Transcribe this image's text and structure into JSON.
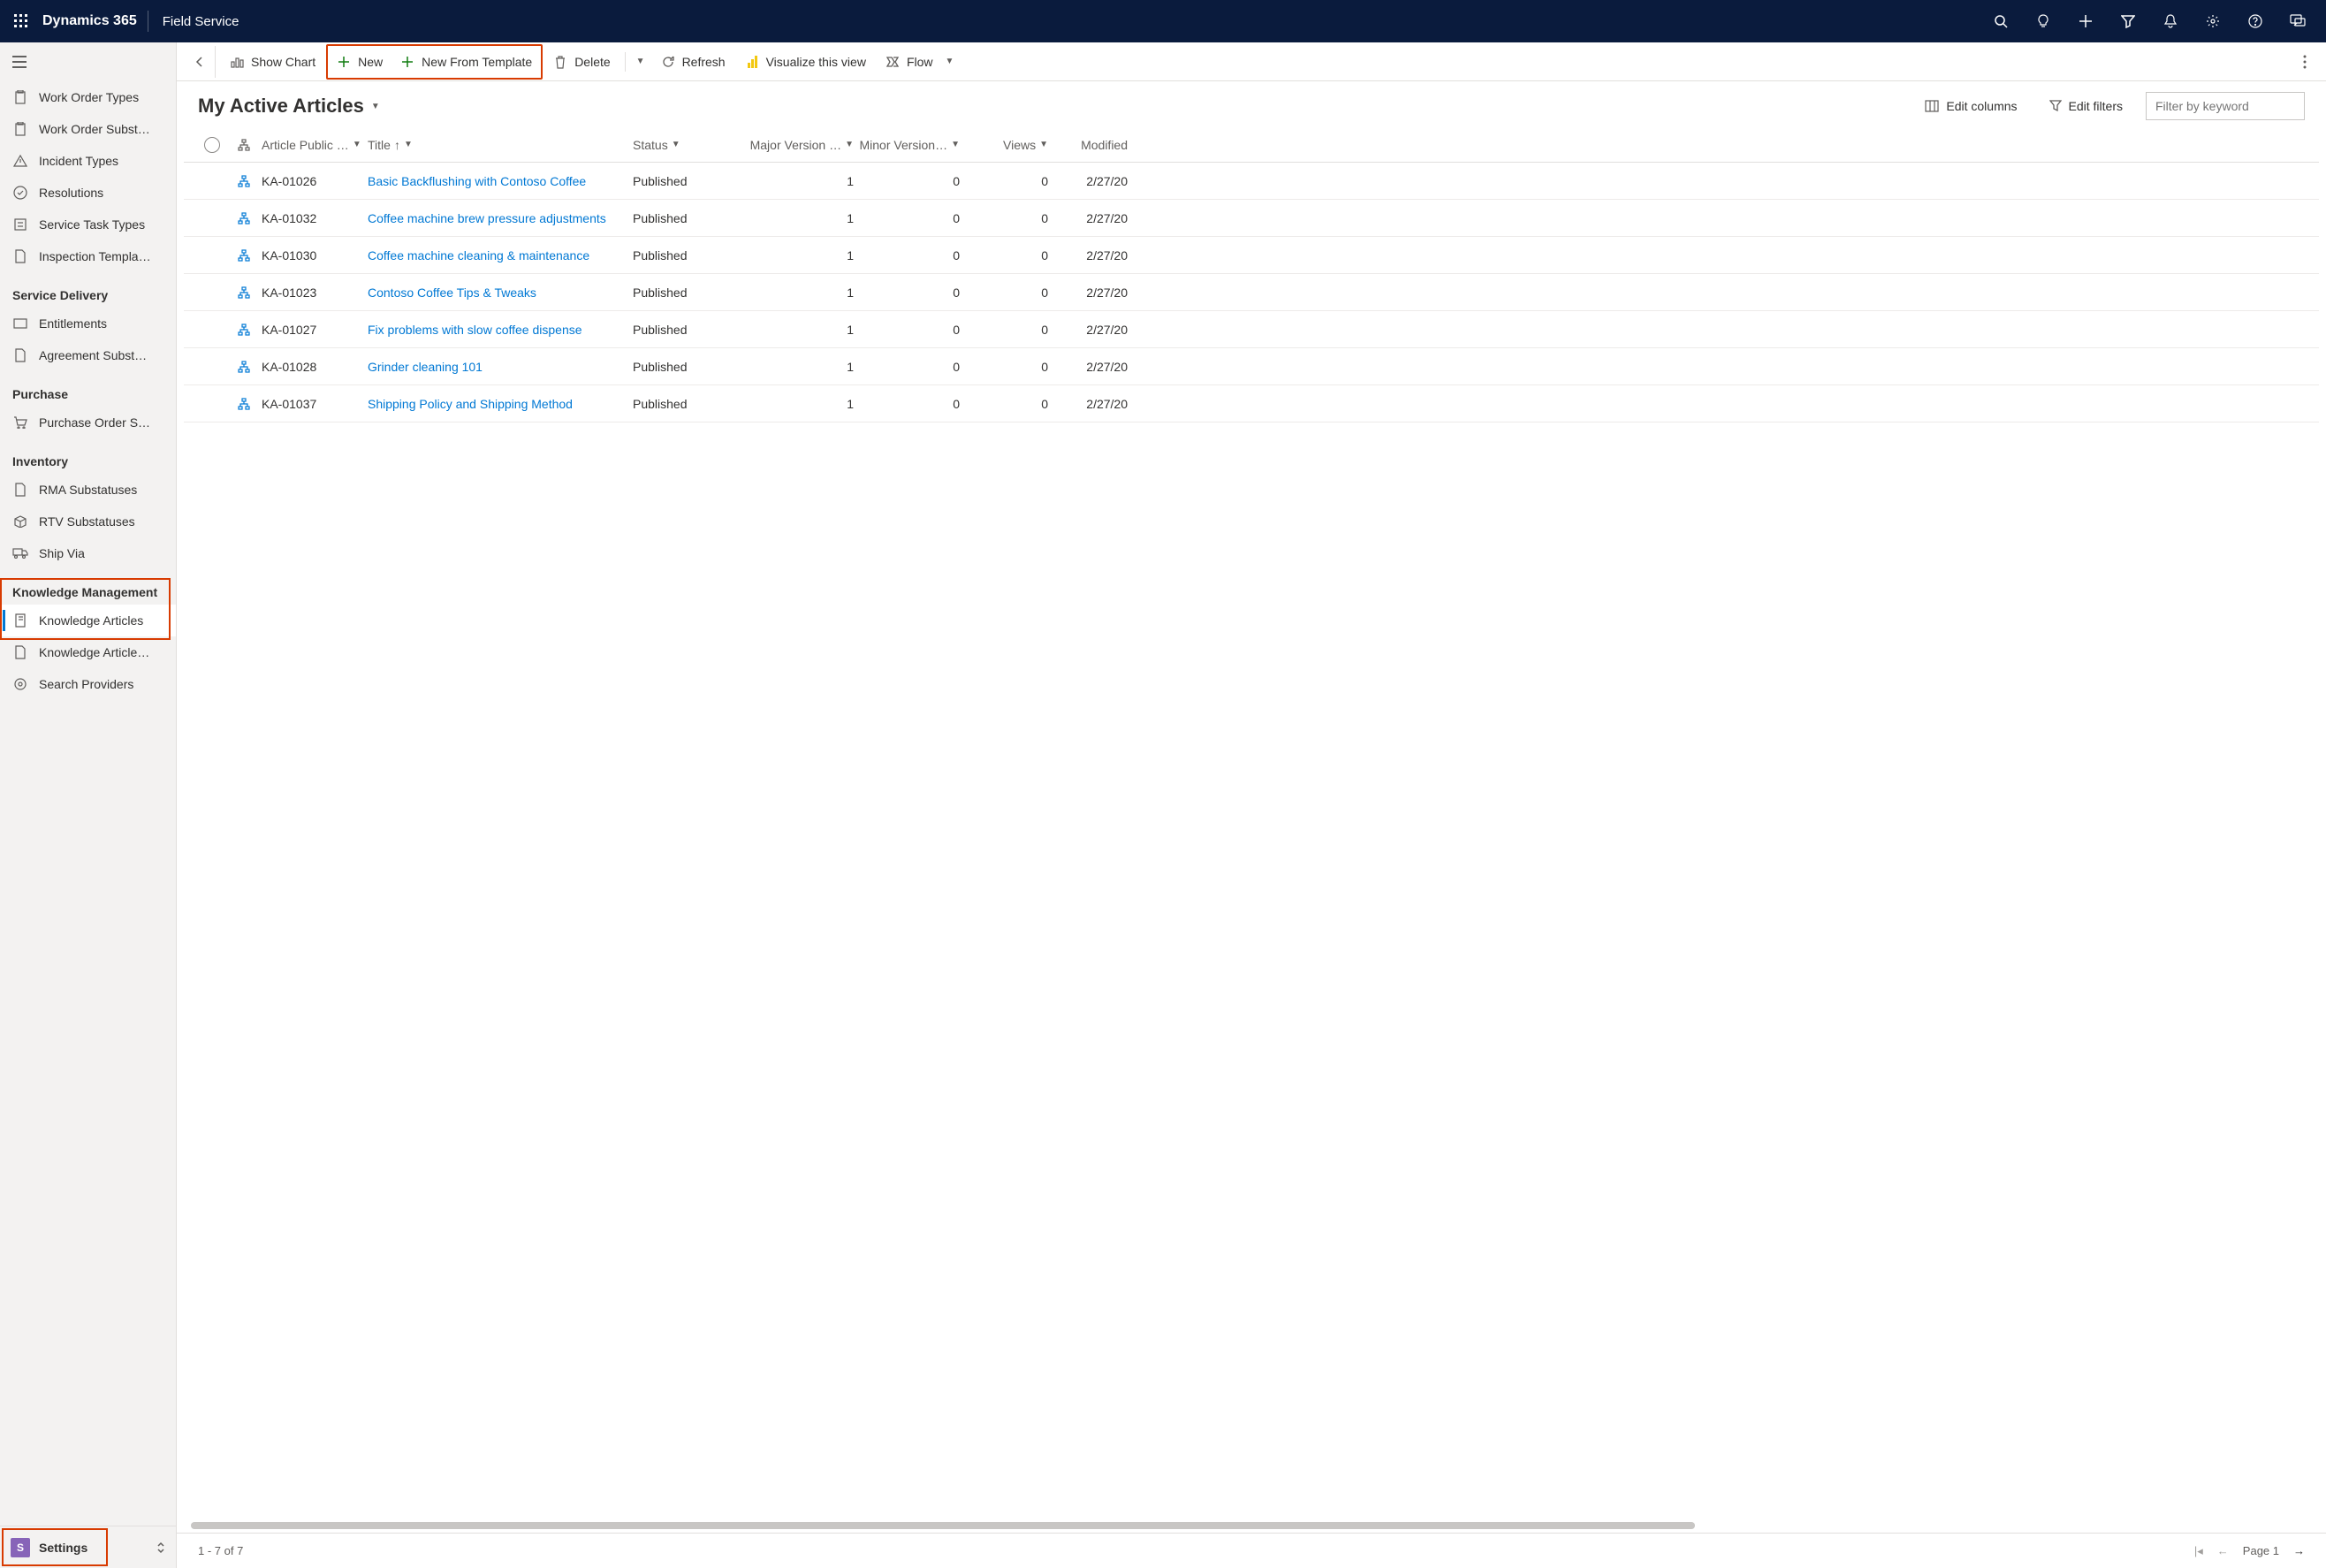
{
  "topbar": {
    "brand": "Dynamics 365",
    "app": "Field Service"
  },
  "sidebar": {
    "items1": [
      {
        "label": "Work Order Types"
      },
      {
        "label": "Work Order Subst…"
      },
      {
        "label": "Incident Types"
      },
      {
        "label": "Resolutions"
      },
      {
        "label": "Service Task Types"
      },
      {
        "label": "Inspection Templa…"
      }
    ],
    "heading_service": "Service Delivery",
    "items_service": [
      {
        "label": "Entitlements"
      },
      {
        "label": "Agreement Subst…"
      }
    ],
    "heading_purchase": "Purchase",
    "items_purchase": [
      {
        "label": "Purchase Order S…"
      }
    ],
    "heading_inventory": "Inventory",
    "items_inventory": [
      {
        "label": "RMA Substatuses"
      },
      {
        "label": "RTV Substatuses"
      },
      {
        "label": "Ship Via"
      }
    ],
    "heading_km": "Knowledge Management",
    "items_km": [
      {
        "label": "Knowledge Articles"
      },
      {
        "label": "Knowledge Article…"
      },
      {
        "label": "Search Providers"
      }
    ],
    "area_badge": "S",
    "area_label": "Settings"
  },
  "cmdbar": {
    "show_chart": "Show Chart",
    "new": "New",
    "new_template": "New From Template",
    "delete": "Delete",
    "refresh": "Refresh",
    "visualize": "Visualize this view",
    "flow": "Flow"
  },
  "view": {
    "title": "My Active Articles",
    "edit_columns": "Edit columns",
    "edit_filters": "Edit filters",
    "filter_placeholder": "Filter by keyword"
  },
  "grid": {
    "headers": {
      "article_num": "Article Public …",
      "title": "Title",
      "status": "Status",
      "major": "Major Version …",
      "minor": "Minor Version…",
      "views": "Views",
      "modified": "Modified"
    },
    "rows": [
      {
        "num": "KA-01026",
        "title": "Basic Backflushing with Contoso Coffee",
        "status": "Published",
        "major": "1",
        "minor": "0",
        "views": "0",
        "mod": "2/27/20"
      },
      {
        "num": "KA-01032",
        "title": "Coffee machine brew pressure adjustments",
        "status": "Published",
        "major": "1",
        "minor": "0",
        "views": "0",
        "mod": "2/27/20"
      },
      {
        "num": "KA-01030",
        "title": "Coffee machine cleaning & maintenance",
        "status": "Published",
        "major": "1",
        "minor": "0",
        "views": "0",
        "mod": "2/27/20"
      },
      {
        "num": "KA-01023",
        "title": "Contoso Coffee Tips & Tweaks",
        "status": "Published",
        "major": "1",
        "minor": "0",
        "views": "0",
        "mod": "2/27/20"
      },
      {
        "num": "KA-01027",
        "title": "Fix problems with slow coffee dispense",
        "status": "Published",
        "major": "1",
        "minor": "0",
        "views": "0",
        "mod": "2/27/20"
      },
      {
        "num": "KA-01028",
        "title": "Grinder cleaning 101",
        "status": "Published",
        "major": "1",
        "minor": "0",
        "views": "0",
        "mod": "2/27/20"
      },
      {
        "num": "KA-01037",
        "title": "Shipping Policy and Shipping Method",
        "status": "Published",
        "major": "1",
        "minor": "0",
        "views": "0",
        "mod": "2/27/20"
      }
    ]
  },
  "footer": {
    "count": "1 - 7 of 7",
    "page": "Page 1"
  }
}
